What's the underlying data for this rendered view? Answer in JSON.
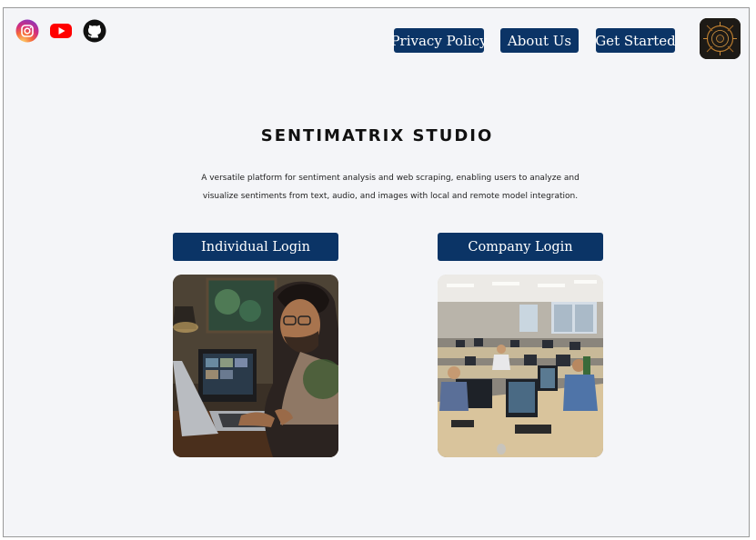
{
  "social": {
    "icons": [
      {
        "name": "instagram-icon",
        "color": "#e1306c"
      },
      {
        "name": "youtube-icon",
        "color": "#ff0000"
      },
      {
        "name": "github-icon",
        "color": "#111111"
      }
    ]
  },
  "nav": {
    "privacy_label": "Privacy Policy",
    "about_label": "About Us",
    "started_label": "Get Started"
  },
  "hero": {
    "title": "SENTIMATRIX STUDIO",
    "description": "A versatile platform for sentiment analysis and web scraping, enabling users to analyze and visualize sentiments from text, audio, and images with local and remote model integration."
  },
  "login": {
    "individual_label": "Individual Login",
    "company_label": "Company Login"
  },
  "colors": {
    "accent": "#0b3466",
    "background": "#f4f5f8"
  }
}
